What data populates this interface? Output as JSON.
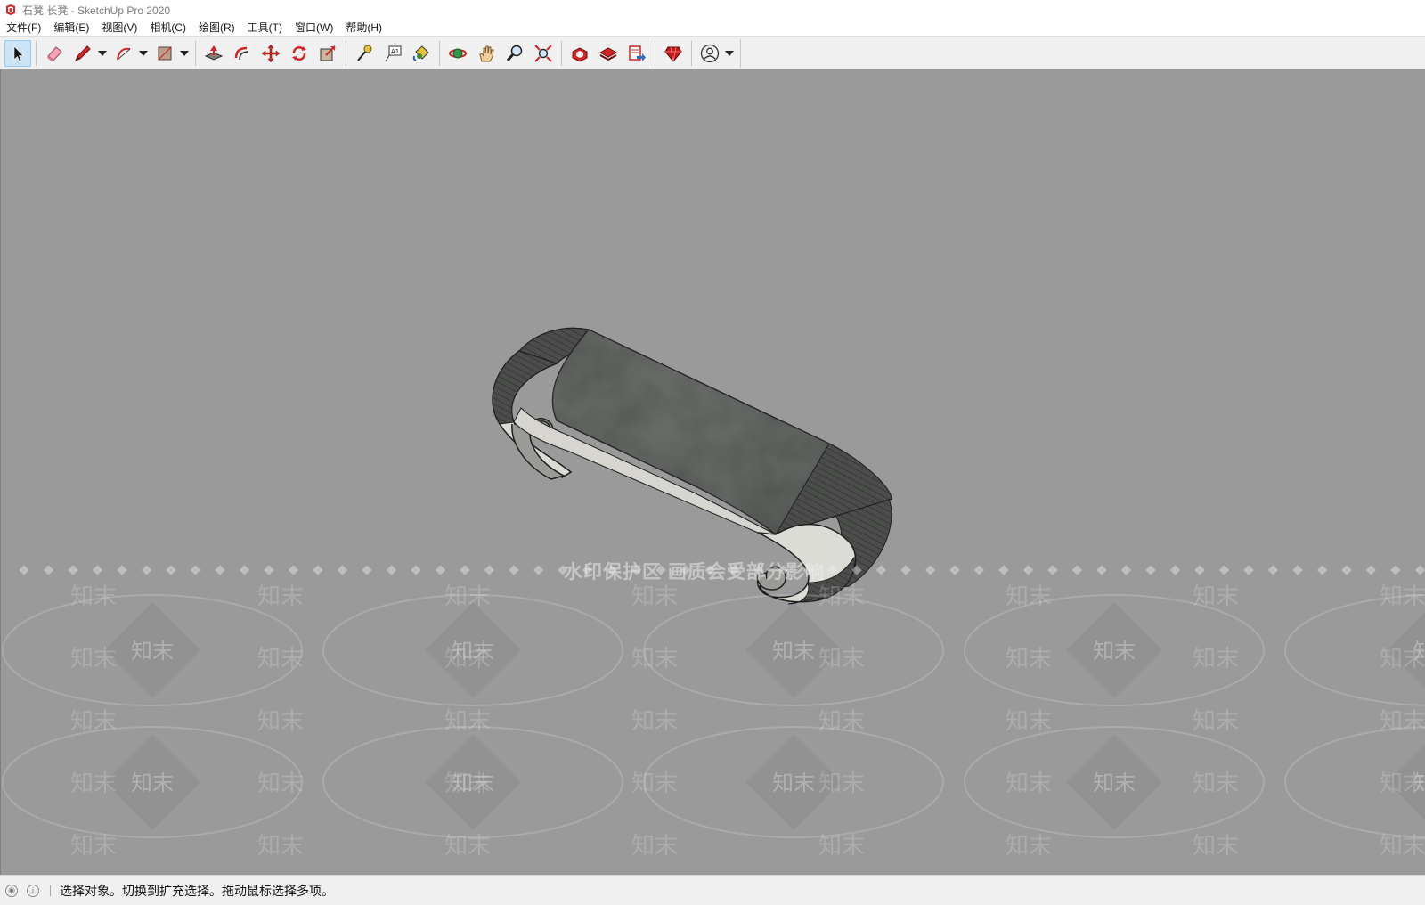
{
  "window": {
    "title": "石凳 长凳 - SketchUp Pro 2020"
  },
  "menu": [
    "文件(F)",
    "编辑(E)",
    "视图(V)",
    "相机(C)",
    "绘图(R)",
    "工具(T)",
    "窗口(W)",
    "帮助(H)"
  ],
  "toolbar": {
    "tools": [
      {
        "name": "select-tool",
        "icon": "arrow-icon",
        "active": true
      },
      {
        "name": "eraser-tool",
        "icon": "eraser-icon"
      },
      {
        "name": "line-tool",
        "icon": "pencil-icon",
        "dropdown": true
      },
      {
        "name": "arc-tool",
        "icon": "arc-icon",
        "dropdown": true
      },
      {
        "name": "shape-tool",
        "icon": "rectangle-icon",
        "dropdown": true
      },
      {
        "name": "push-pull-tool",
        "icon": "push-pull-icon"
      },
      {
        "name": "offset-tool",
        "icon": "offset-icon"
      },
      {
        "name": "move-tool",
        "icon": "move-icon"
      },
      {
        "name": "rotate-tool",
        "icon": "rotate-icon"
      },
      {
        "name": "scale-tool",
        "icon": "scale-icon"
      },
      {
        "name": "tape-measure-tool",
        "icon": "tape-measure-icon"
      },
      {
        "name": "text-tool",
        "icon": "text-icon",
        "label": "A1"
      },
      {
        "name": "paint-bucket-tool",
        "icon": "paint-bucket-icon"
      },
      {
        "name": "orbit-tool",
        "icon": "orbit-icon"
      },
      {
        "name": "pan-tool",
        "icon": "hand-icon"
      },
      {
        "name": "zoom-tool",
        "icon": "magnifier-icon"
      },
      {
        "name": "zoom-extents-tool",
        "icon": "zoom-extents-icon"
      },
      {
        "name": "warehouse-tool",
        "icon": "warehouse-icon"
      },
      {
        "name": "extension-warehouse-tool",
        "icon": "extension-warehouse-icon"
      },
      {
        "name": "layout-tool",
        "icon": "send-to-layout-icon"
      },
      {
        "name": "ruby-console-tool",
        "icon": "ruby-icon"
      },
      {
        "name": "account-tool",
        "icon": "user-icon",
        "dropdown": true
      }
    ]
  },
  "viewport": {
    "background": "#9a9a9a",
    "watermark_caption": "水印保护区   画质会受部分影响",
    "watermark_text": "知末"
  },
  "status": {
    "message": "选择对象。切换到扩充选择。拖动鼠标选择多项。"
  },
  "colors": {
    "accent_red": "#d42424",
    "toolbar_active": "#cce4f7"
  }
}
